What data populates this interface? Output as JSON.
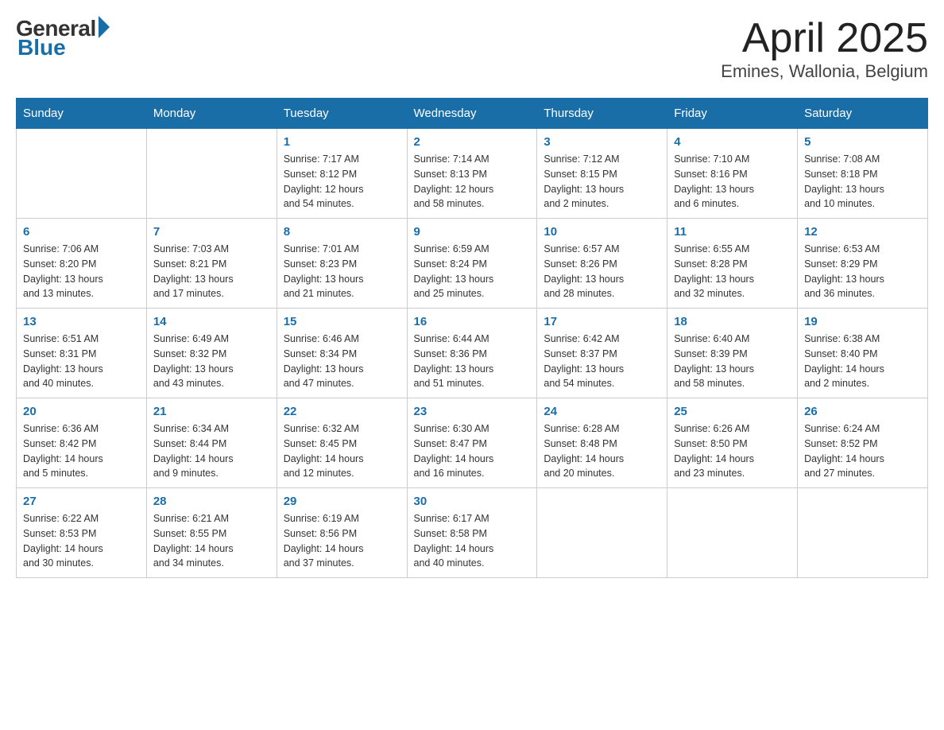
{
  "logo": {
    "general": "General",
    "blue": "Blue"
  },
  "title": "April 2025",
  "subtitle": "Emines, Wallonia, Belgium",
  "days_of_week": [
    "Sunday",
    "Monday",
    "Tuesday",
    "Wednesday",
    "Thursday",
    "Friday",
    "Saturday"
  ],
  "weeks": [
    [
      {
        "day": "",
        "info": ""
      },
      {
        "day": "",
        "info": ""
      },
      {
        "day": "1",
        "info": "Sunrise: 7:17 AM\nSunset: 8:12 PM\nDaylight: 12 hours\nand 54 minutes."
      },
      {
        "day": "2",
        "info": "Sunrise: 7:14 AM\nSunset: 8:13 PM\nDaylight: 12 hours\nand 58 minutes."
      },
      {
        "day": "3",
        "info": "Sunrise: 7:12 AM\nSunset: 8:15 PM\nDaylight: 13 hours\nand 2 minutes."
      },
      {
        "day": "4",
        "info": "Sunrise: 7:10 AM\nSunset: 8:16 PM\nDaylight: 13 hours\nand 6 minutes."
      },
      {
        "day": "5",
        "info": "Sunrise: 7:08 AM\nSunset: 8:18 PM\nDaylight: 13 hours\nand 10 minutes."
      }
    ],
    [
      {
        "day": "6",
        "info": "Sunrise: 7:06 AM\nSunset: 8:20 PM\nDaylight: 13 hours\nand 13 minutes."
      },
      {
        "day": "7",
        "info": "Sunrise: 7:03 AM\nSunset: 8:21 PM\nDaylight: 13 hours\nand 17 minutes."
      },
      {
        "day": "8",
        "info": "Sunrise: 7:01 AM\nSunset: 8:23 PM\nDaylight: 13 hours\nand 21 minutes."
      },
      {
        "day": "9",
        "info": "Sunrise: 6:59 AM\nSunset: 8:24 PM\nDaylight: 13 hours\nand 25 minutes."
      },
      {
        "day": "10",
        "info": "Sunrise: 6:57 AM\nSunset: 8:26 PM\nDaylight: 13 hours\nand 28 minutes."
      },
      {
        "day": "11",
        "info": "Sunrise: 6:55 AM\nSunset: 8:28 PM\nDaylight: 13 hours\nand 32 minutes."
      },
      {
        "day": "12",
        "info": "Sunrise: 6:53 AM\nSunset: 8:29 PM\nDaylight: 13 hours\nand 36 minutes."
      }
    ],
    [
      {
        "day": "13",
        "info": "Sunrise: 6:51 AM\nSunset: 8:31 PM\nDaylight: 13 hours\nand 40 minutes."
      },
      {
        "day": "14",
        "info": "Sunrise: 6:49 AM\nSunset: 8:32 PM\nDaylight: 13 hours\nand 43 minutes."
      },
      {
        "day": "15",
        "info": "Sunrise: 6:46 AM\nSunset: 8:34 PM\nDaylight: 13 hours\nand 47 minutes."
      },
      {
        "day": "16",
        "info": "Sunrise: 6:44 AM\nSunset: 8:36 PM\nDaylight: 13 hours\nand 51 minutes."
      },
      {
        "day": "17",
        "info": "Sunrise: 6:42 AM\nSunset: 8:37 PM\nDaylight: 13 hours\nand 54 minutes."
      },
      {
        "day": "18",
        "info": "Sunrise: 6:40 AM\nSunset: 8:39 PM\nDaylight: 13 hours\nand 58 minutes."
      },
      {
        "day": "19",
        "info": "Sunrise: 6:38 AM\nSunset: 8:40 PM\nDaylight: 14 hours\nand 2 minutes."
      }
    ],
    [
      {
        "day": "20",
        "info": "Sunrise: 6:36 AM\nSunset: 8:42 PM\nDaylight: 14 hours\nand 5 minutes."
      },
      {
        "day": "21",
        "info": "Sunrise: 6:34 AM\nSunset: 8:44 PM\nDaylight: 14 hours\nand 9 minutes."
      },
      {
        "day": "22",
        "info": "Sunrise: 6:32 AM\nSunset: 8:45 PM\nDaylight: 14 hours\nand 12 minutes."
      },
      {
        "day": "23",
        "info": "Sunrise: 6:30 AM\nSunset: 8:47 PM\nDaylight: 14 hours\nand 16 minutes."
      },
      {
        "day": "24",
        "info": "Sunrise: 6:28 AM\nSunset: 8:48 PM\nDaylight: 14 hours\nand 20 minutes."
      },
      {
        "day": "25",
        "info": "Sunrise: 6:26 AM\nSunset: 8:50 PM\nDaylight: 14 hours\nand 23 minutes."
      },
      {
        "day": "26",
        "info": "Sunrise: 6:24 AM\nSunset: 8:52 PM\nDaylight: 14 hours\nand 27 minutes."
      }
    ],
    [
      {
        "day": "27",
        "info": "Sunrise: 6:22 AM\nSunset: 8:53 PM\nDaylight: 14 hours\nand 30 minutes."
      },
      {
        "day": "28",
        "info": "Sunrise: 6:21 AM\nSunset: 8:55 PM\nDaylight: 14 hours\nand 34 minutes."
      },
      {
        "day": "29",
        "info": "Sunrise: 6:19 AM\nSunset: 8:56 PM\nDaylight: 14 hours\nand 37 minutes."
      },
      {
        "day": "30",
        "info": "Sunrise: 6:17 AM\nSunset: 8:58 PM\nDaylight: 14 hours\nand 40 minutes."
      },
      {
        "day": "",
        "info": ""
      },
      {
        "day": "",
        "info": ""
      },
      {
        "day": "",
        "info": ""
      }
    ]
  ]
}
